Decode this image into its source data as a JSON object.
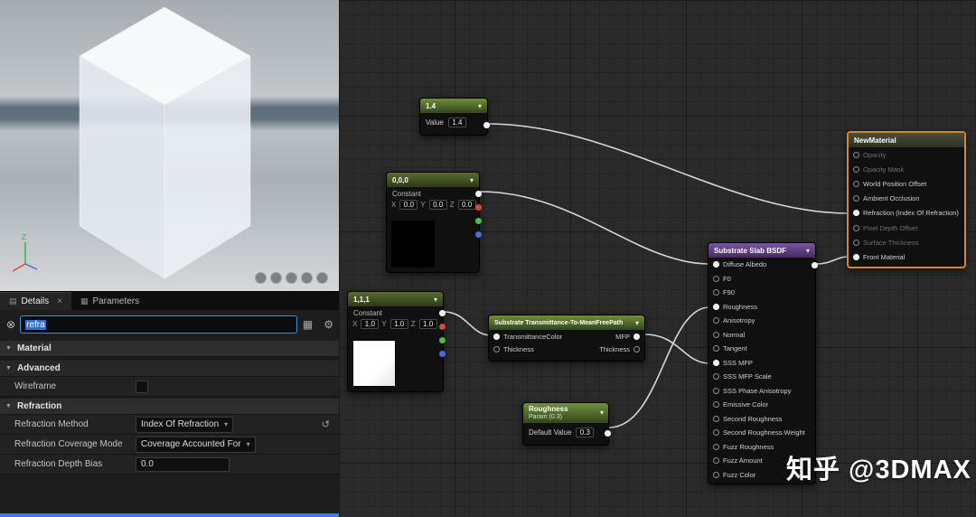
{
  "colors": {
    "accent_blue": "#3d7de0",
    "node_header_green": "#6f8f3b",
    "node_header_purple": "#7b55a2",
    "material_border_orange": "#d8862a"
  },
  "viewport": {
    "gizmo_z": "Z"
  },
  "details": {
    "tab_details": "Details",
    "tab_parameters": "Parameters",
    "search_value": "refra",
    "section_material": "Material",
    "section_advanced": "Advanced",
    "section_refraction": "Refraction",
    "row_wireframe_label": "Wireframe",
    "row_method_label": "Refraction Method",
    "row_method_value": "Index Of Refraction",
    "row_coverage_label": "Refraction Coverage Mode",
    "row_coverage_value": "Coverage Accounted For",
    "row_depthbias_label": "Refraction Depth Bias",
    "row_depthbias_value": "0.0"
  },
  "graph": {
    "node_14": {
      "title": "1.4",
      "value_label": "Value",
      "value": "1.4"
    },
    "node_000": {
      "title": "0,0,0",
      "subtitle": "Constant",
      "label_x": "X",
      "label_y": "Y",
      "label_z": "Z",
      "x": "0.0",
      "y": "0.0",
      "z": "0.0"
    },
    "node_111": {
      "title": "1,1,1",
      "subtitle": "Constant",
      "label_x": "X",
      "label_y": "Y",
      "label_z": "Z",
      "x": "1.0",
      "y": "1.0",
      "z": "1.0"
    },
    "node_transmittance": {
      "title": "Substrate Transmittance-To-MeanFreePath",
      "in_0": "TransmittanceColor",
      "in_1": "Thickness",
      "out_0": "MFP",
      "out_1": "Thickness"
    },
    "node_roughness": {
      "title": "Roughness",
      "subtitle": "Param (0.3)",
      "value_label": "Default Value",
      "value": "0.3"
    },
    "node_slab": {
      "title": "Substrate Slab BSDF",
      "pins": [
        "Diffuse Albedo",
        "F0",
        "F90",
        "Roughness",
        "Anisotropy",
        "Normal",
        "Tangent",
        "SSS MFP",
        "SSS MFP Scale",
        "SSS Phase Anisotropy",
        "Emissive Color",
        "Second Roughness",
        "Second Roughness Weight",
        "Fuzz Roughness",
        "Fuzz Amount",
        "Fuzz Color"
      ]
    },
    "node_material": {
      "title": "NewMaterial",
      "pins": [
        "Opacity",
        "Opacity Mask",
        "World Position Offset",
        "Ambient Occlusion",
        "Refraction (Index Of Refraction)",
        "Pixel Depth Offset",
        "Surface Thickness",
        "Front Material"
      ]
    }
  },
  "watermark": "知乎 @3DMAX"
}
